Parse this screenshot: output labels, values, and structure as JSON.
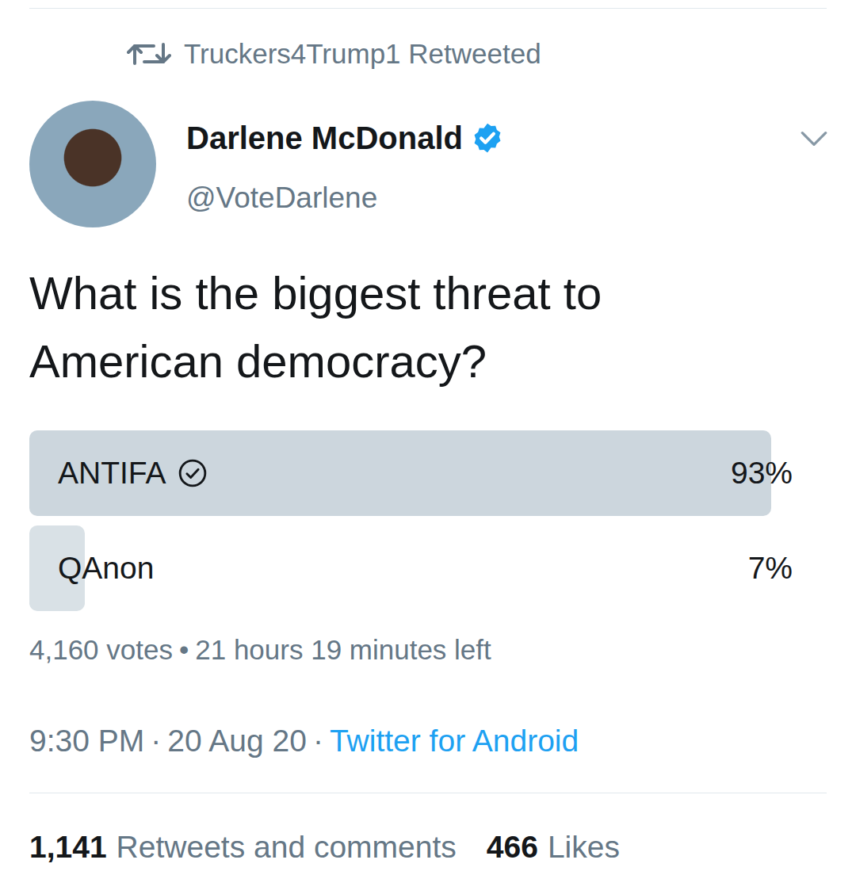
{
  "retweet": {
    "text": "Truckers4Trump1 Retweeted"
  },
  "author": {
    "name": "Darlene McDonald",
    "handle": "@VoteDarlene",
    "verified": true
  },
  "text": "What is the biggest threat to American democracy?",
  "poll": {
    "options": [
      {
        "label": "ANTIFA",
        "percent": "93%",
        "level": 0.93,
        "selected": true
      },
      {
        "label": "QAnon",
        "percent": "7%",
        "level": 0.07,
        "selected": false
      }
    ],
    "votes": "4,160 votes",
    "separator": "•",
    "time_left": "21 hours 19 minutes left"
  },
  "meta": {
    "time": "9:30 PM",
    "date": "20 Aug 20",
    "source": "Twitter for Android",
    "separator": "·"
  },
  "stats": [
    {
      "count": "1,141",
      "label": "Retweets and comments"
    },
    {
      "count": "466",
      "label": "Likes"
    }
  ]
}
